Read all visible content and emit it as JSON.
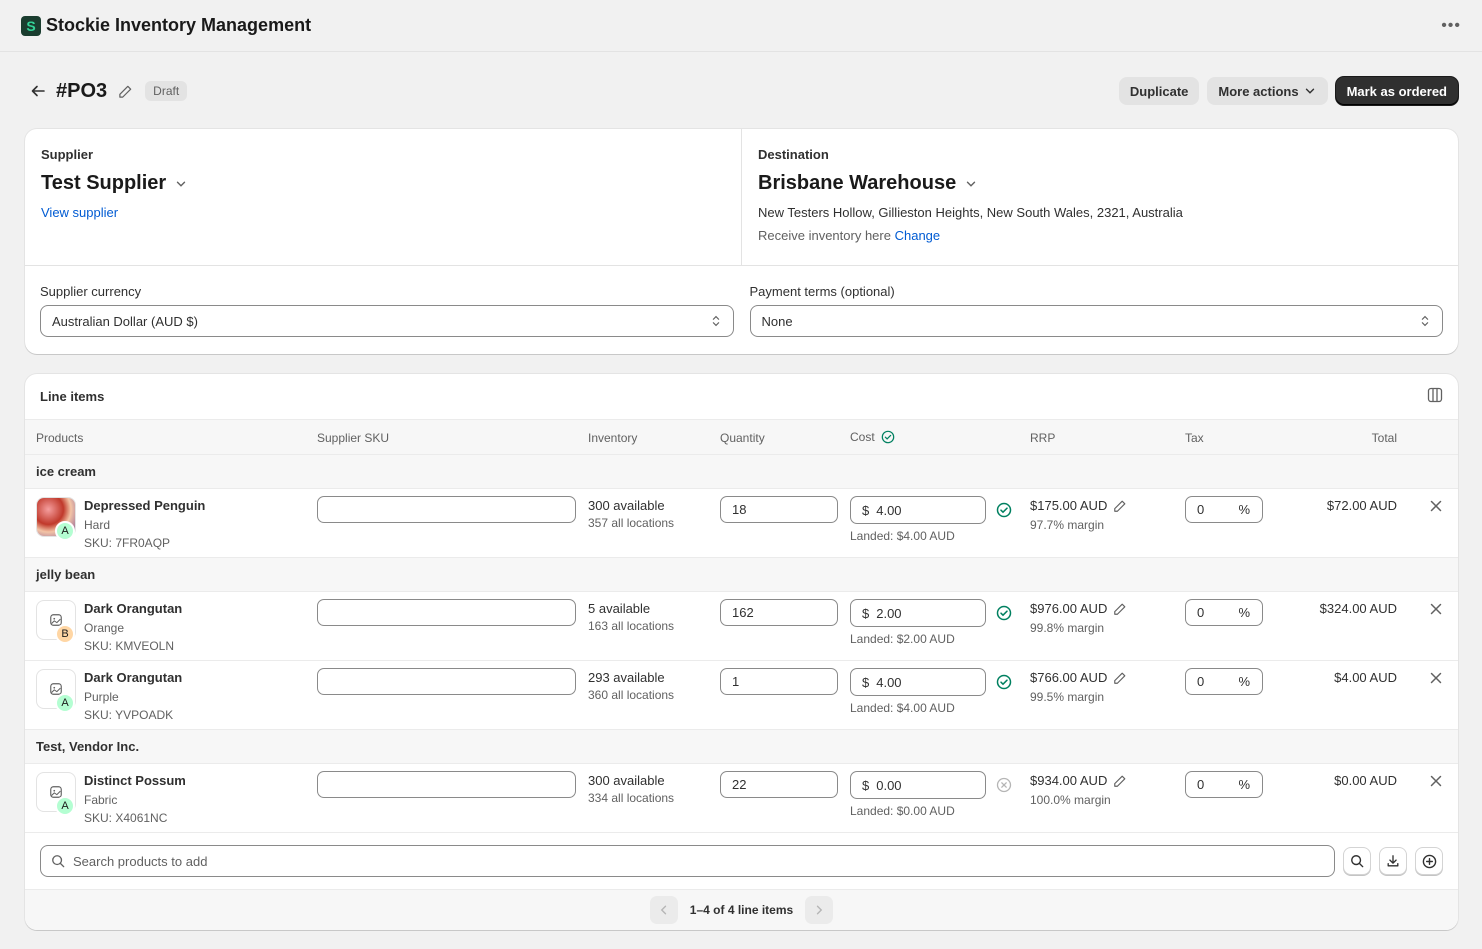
{
  "app": {
    "title": "Stockie Inventory Management",
    "logo_letter": "S"
  },
  "header": {
    "po_number": "#PO3",
    "status": "Draft",
    "duplicate_label": "Duplicate",
    "more_actions_label": "More actions",
    "mark_ordered_label": "Mark as ordered"
  },
  "supplier": {
    "label": "Supplier",
    "name": "Test Supplier",
    "view_link": "View supplier"
  },
  "destination": {
    "label": "Destination",
    "name": "Brisbane Warehouse",
    "address": "New Testers Hollow, Gillieston Heights, New South Wales, 2321, Australia",
    "receive_text": "Receive inventory here",
    "change_link": "Change"
  },
  "currency": {
    "label": "Supplier currency",
    "value": "Australian Dollar (AUD $)"
  },
  "payment_terms": {
    "label": "Payment terms (optional)",
    "value": "None"
  },
  "line_items": {
    "title": "Line items",
    "columns": {
      "products": "Products",
      "supplier_sku": "Supplier SKU",
      "inventory": "Inventory",
      "quantity": "Quantity",
      "cost": "Cost",
      "rrp": "RRP",
      "tax": "Tax",
      "total": "Total"
    },
    "groups": [
      {
        "name": "ice cream"
      },
      {
        "name": "jelly bean"
      },
      {
        "name": "Test, Vendor Inc."
      }
    ],
    "items": [
      {
        "name": "Depressed Penguin",
        "variant": "Hard",
        "sku": "SKU: 7FR0AQP",
        "grade": "A",
        "supplier_sku": "",
        "available": "300 available",
        "all_locations": "357 all locations",
        "quantity": "18",
        "currency_symbol": "$",
        "cost": "4.00",
        "landed": "Landed: $4.00 AUD",
        "rrp": "$175.00 AUD",
        "margin": "97.7% margin",
        "tax": "0",
        "tax_unit": "%",
        "total": "$72.00 AUD"
      },
      {
        "name": "Dark Orangutan",
        "variant": "Orange",
        "sku": "SKU: KMVEOLN",
        "grade": "B",
        "supplier_sku": "",
        "available": "5 available",
        "all_locations": "163 all locations",
        "quantity": "162",
        "currency_symbol": "$",
        "cost": "2.00",
        "landed": "Landed: $2.00 AUD",
        "rrp": "$976.00 AUD",
        "margin": "99.8% margin",
        "tax": "0",
        "tax_unit": "%",
        "total": "$324.00 AUD"
      },
      {
        "name": "Dark Orangutan",
        "variant": "Purple",
        "sku": "SKU: YVPOADK",
        "grade": "A",
        "supplier_sku": "",
        "available": "293 available",
        "all_locations": "360 all locations",
        "quantity": "1",
        "currency_symbol": "$",
        "cost": "4.00",
        "landed": "Landed: $4.00 AUD",
        "rrp": "$766.00 AUD",
        "margin": "99.5% margin",
        "tax": "0",
        "tax_unit": "%",
        "total": "$4.00 AUD"
      },
      {
        "name": "Distinct Possum",
        "variant": "Fabric",
        "sku": "SKU: X4061NC",
        "grade": "A",
        "supplier_sku": "",
        "available": "300 available",
        "all_locations": "334 all locations",
        "quantity": "22",
        "currency_symbol": "$",
        "cost": "0.00",
        "landed": "Landed: $0.00 AUD",
        "rrp": "$934.00 AUD",
        "margin": "100.0% margin",
        "tax": "0",
        "tax_unit": "%",
        "total": "$0.00 AUD"
      }
    ],
    "search_placeholder": "Search products to add",
    "pagination": "1–4 of 4 line items"
  },
  "colors": {
    "primary": "#303030",
    "link": "#005bd3",
    "success": "#008060",
    "grade_a": "#b4fed2",
    "grade_b": "#ffd6a4"
  }
}
